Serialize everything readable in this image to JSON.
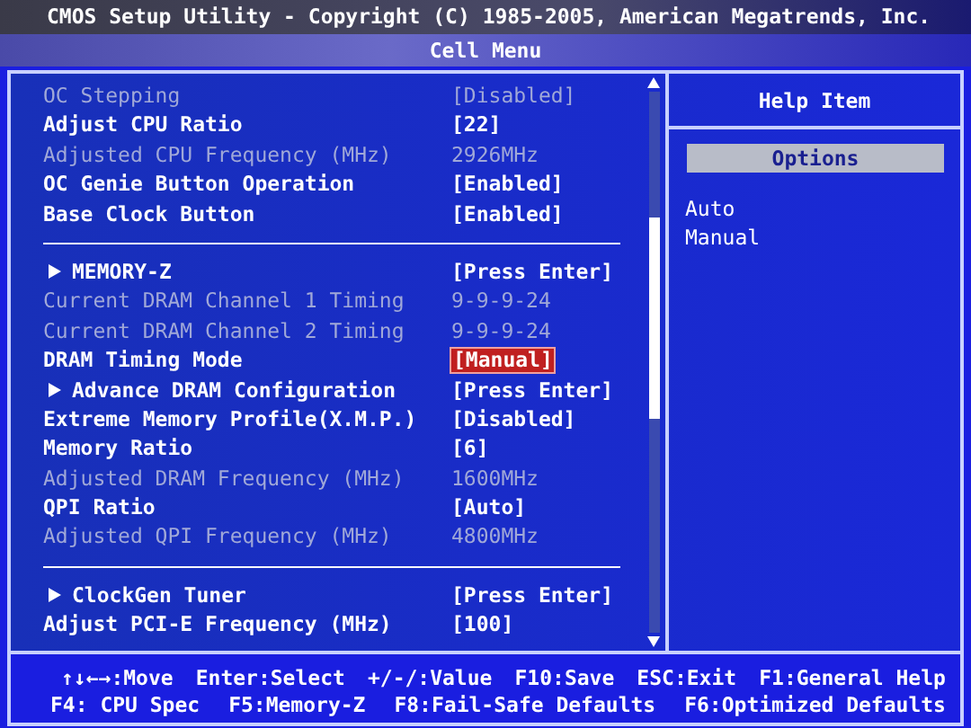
{
  "header": {
    "title": "CMOS Setup Utility - Copyright (C) 1985-2005, American Megatrends, Inc.",
    "subtitle": "Cell Menu"
  },
  "groups": [
    [
      {
        "kind": "setting",
        "label": "OC Stepping",
        "value": "[Disabled]",
        "disabled": true,
        "selected": false
      },
      {
        "kind": "setting",
        "label": "Adjust CPU Ratio",
        "value": "[22]",
        "disabled": false,
        "selected": false
      },
      {
        "kind": "setting",
        "label": "Adjusted CPU Frequency (MHz)",
        "value": "2926MHz",
        "disabled": true,
        "selected": false
      },
      {
        "kind": "setting",
        "label": "OC Genie Button Operation",
        "value": "[Enabled]",
        "disabled": false,
        "selected": false
      },
      {
        "kind": "setting",
        "label": "Base Clock Button",
        "value": "[Enabled]",
        "disabled": false,
        "selected": false
      }
    ],
    [
      {
        "kind": "submenu",
        "label": "MEMORY-Z",
        "value": "[Press Enter]",
        "disabled": false,
        "selected": false
      },
      {
        "kind": "setting",
        "label": "Current DRAM Channel 1 Timing",
        "value": "9-9-9-24",
        "disabled": true,
        "selected": false
      },
      {
        "kind": "setting",
        "label": "Current DRAM Channel 2 Timing",
        "value": "9-9-9-24",
        "disabled": true,
        "selected": false
      },
      {
        "kind": "setting",
        "label": "DRAM Timing Mode",
        "value": "[Manual]",
        "disabled": false,
        "selected": true
      },
      {
        "kind": "submenu",
        "label": "Advance DRAM Configuration",
        "value": "[Press Enter]",
        "disabled": false,
        "selected": false
      },
      {
        "kind": "setting",
        "label": "Extreme Memory Profile(X.M.P.)",
        "value": "[Disabled]",
        "disabled": false,
        "selected": false
      },
      {
        "kind": "setting",
        "label": "Memory Ratio",
        "value": "[6]",
        "disabled": false,
        "selected": false
      },
      {
        "kind": "setting",
        "label": "Adjusted DRAM Frequency (MHz)",
        "value": "1600MHz",
        "disabled": true,
        "selected": false
      },
      {
        "kind": "setting",
        "label": "QPI Ratio",
        "value": "[Auto]",
        "disabled": false,
        "selected": false
      },
      {
        "kind": "setting",
        "label": "Adjusted QPI Frequency (MHz)",
        "value": "4800MHz",
        "disabled": true,
        "selected": false
      }
    ],
    [
      {
        "kind": "submenu",
        "label": "ClockGen Tuner",
        "value": "[Press Enter]",
        "disabled": false,
        "selected": false
      },
      {
        "kind": "setting",
        "label": "Adjust PCI-E Frequency (MHz)",
        "value": "[100]",
        "disabled": false,
        "selected": false
      }
    ]
  ],
  "help": {
    "title": "Help Item",
    "options_heading": "Options",
    "options": [
      "Auto",
      "Manual"
    ]
  },
  "footer": [
    [
      "↑↓←→:Move",
      "Enter:Select",
      "+/-/:Value",
      "F10:Save",
      "ESC:Exit",
      "F1:General Help"
    ],
    [
      "F4: CPU Spec",
      "F5:Memory-Z",
      "F8:Fail-Safe Defaults",
      "F6:Optimized Defaults"
    ]
  ]
}
